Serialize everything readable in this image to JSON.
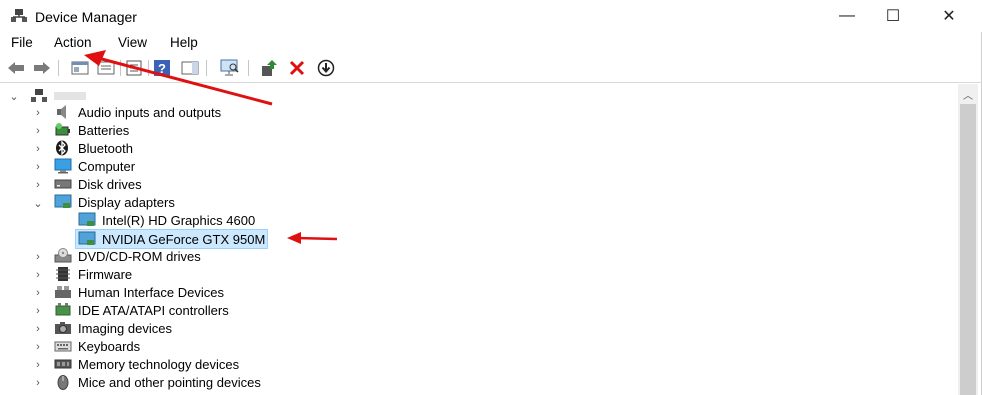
{
  "window": {
    "title": "Device Manager",
    "controls": {
      "minimize": "—",
      "maximize": "☐",
      "close": "✕"
    }
  },
  "menu": [
    "File",
    "Action",
    "View",
    "Help"
  ],
  "toolbar": {
    "icons": [
      "back-icon",
      "forward-icon",
      "show-hide-console-tree-icon",
      "properties-icon",
      "help-icon",
      "action-pane-icon",
      "scan-hardware-icon",
      "update-driver-icon",
      "uninstall-device-icon",
      "disable-device-icon"
    ],
    "colors": {
      "accent_red": "#e01010",
      "accent_green": "#2e8b2e"
    }
  },
  "tree": {
    "root": {
      "label": "",
      "expanded": true
    },
    "items": [
      {
        "label": "Audio inputs and outputs",
        "icon": "speaker-icon",
        "expanded": false
      },
      {
        "label": "Batteries",
        "icon": "battery-icon",
        "expanded": false
      },
      {
        "label": "Bluetooth",
        "icon": "bluetooth-icon",
        "expanded": false
      },
      {
        "label": "Computer",
        "icon": "computer-icon",
        "expanded": false
      },
      {
        "label": "Disk drives",
        "icon": "disk-drive-icon",
        "expanded": false
      },
      {
        "label": "Display adapters",
        "icon": "display-adapter-icon",
        "expanded": true,
        "children": [
          {
            "label": "Intel(R) HD Graphics 4600",
            "icon": "display-adapter-icon",
            "selected": false
          },
          {
            "label": "NVIDIA GeForce GTX 950M",
            "icon": "display-adapter-icon",
            "selected": true
          }
        ]
      },
      {
        "label": "DVD/CD-ROM drives",
        "icon": "dvd-drive-icon",
        "expanded": false
      },
      {
        "label": "Firmware",
        "icon": "firmware-icon",
        "expanded": false
      },
      {
        "label": "Human Interface Devices",
        "icon": "hid-icon",
        "expanded": false
      },
      {
        "label": "IDE ATA/ATAPI controllers",
        "icon": "ide-controller-icon",
        "expanded": false
      },
      {
        "label": "Imaging devices",
        "icon": "camera-icon",
        "expanded": false
      },
      {
        "label": "Keyboards",
        "icon": "keyboard-icon",
        "expanded": false
      },
      {
        "label": "Memory technology devices",
        "icon": "memory-icon",
        "expanded": false
      },
      {
        "label": "Mice and other pointing devices",
        "icon": "mouse-icon",
        "expanded": false
      }
    ]
  },
  "annotation_color": "#e01010"
}
